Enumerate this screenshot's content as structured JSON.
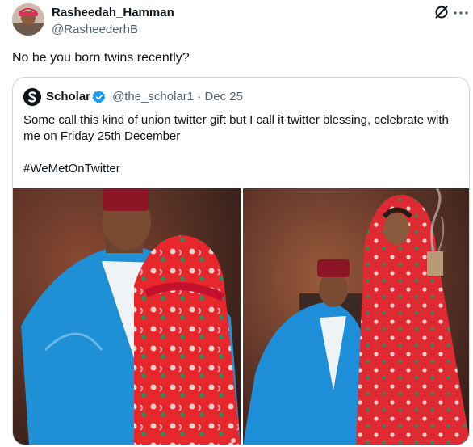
{
  "tweet": {
    "author_name": "Rasheedah_Hamman",
    "author_handle": "@RasheederhB",
    "text": "No be you born twins recently?",
    "avatar_icon": "user-avatar",
    "menu_icon": "grok-icon"
  },
  "quoted": {
    "author_name": "Scholar",
    "author_handle": "@the_scholar1",
    "date": "Dec 25",
    "separator": "·",
    "text": "Some call this kind of union twitter gift but I call it twitter blessing, celebrate with me on Friday 25th December",
    "hashtag": "#WeMetOnTwitter",
    "verified_color": "#1d9bf0",
    "avatar_icon": "scholar-logo"
  },
  "colors": {
    "text": "#0f1419",
    "secondary": "#536471",
    "border": "#cfd9de"
  }
}
